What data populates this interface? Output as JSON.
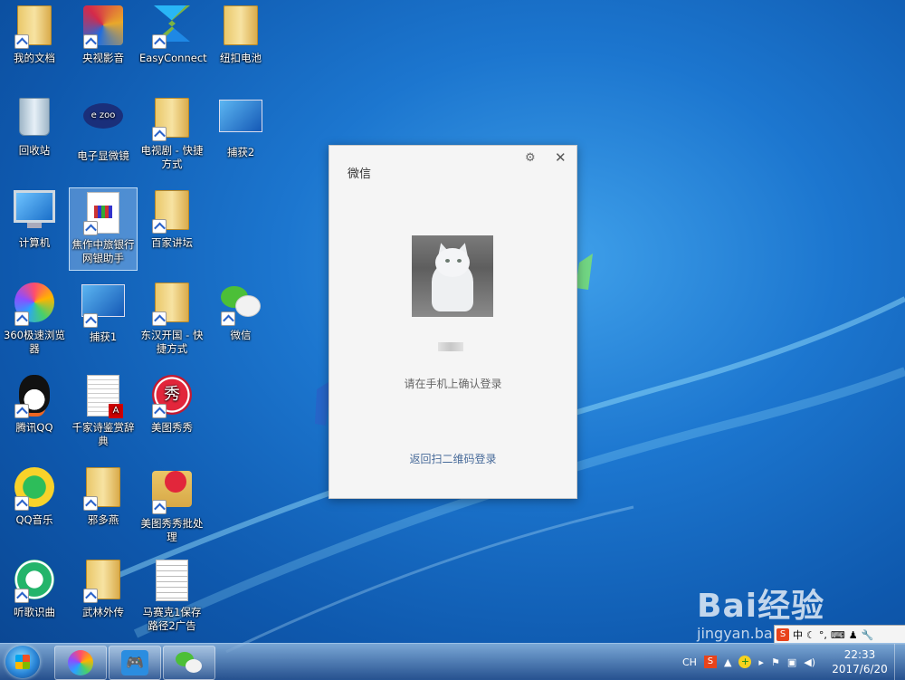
{
  "desktop": {
    "icons": [
      {
        "label": "我的文档"
      },
      {
        "label": "央视影音"
      },
      {
        "label": "EasyConnect"
      },
      {
        "label": "纽扣电池"
      },
      {
        "label": "回收站"
      },
      {
        "label": "电子显微镜"
      },
      {
        "label": "电视剧 - 快捷方式"
      },
      {
        "label": "捕获2"
      },
      {
        "label": "计算机"
      },
      {
        "label": "焦作中旅银行网银助手"
      },
      {
        "label": "百家讲坛"
      },
      {
        "label": "360极速浏览器"
      },
      {
        "label": "捕获1"
      },
      {
        "label": "东汉开国 - 快捷方式"
      },
      {
        "label": "微信"
      },
      {
        "label": "腾讯QQ"
      },
      {
        "label": "千家诗鉴赏辞典"
      },
      {
        "label": "美图秀秀"
      },
      {
        "label": "QQ音乐"
      },
      {
        "label": "邪多燕"
      },
      {
        "label": "美图秀秀批处理"
      },
      {
        "label": "听歌识曲"
      },
      {
        "label": "武林外传"
      },
      {
        "label": "马赛克1保存路径2广告"
      }
    ]
  },
  "wechat_dialog": {
    "title": "微信",
    "settings_icon": "gear-icon",
    "close_icon": "close-icon",
    "confirm_text": "请在手机上确认登录",
    "back_link": "返回扫二维码登录"
  },
  "watermark": {
    "main": "Bai经验",
    "sub": "jingyan.baidu.com"
  },
  "ime_bar": {
    "lang": "中",
    "items": [
      "中",
      "J",
      "°",
      "⌨",
      "♟",
      "🔧"
    ]
  },
  "taskbar": {
    "lang_indicator": "CH",
    "time": "22:33",
    "date": "2017/6/20"
  },
  "colors": {
    "desktop_bg": "#1c76cf",
    "dialog_bg": "#f5f5f5",
    "link": "#486b9a"
  }
}
